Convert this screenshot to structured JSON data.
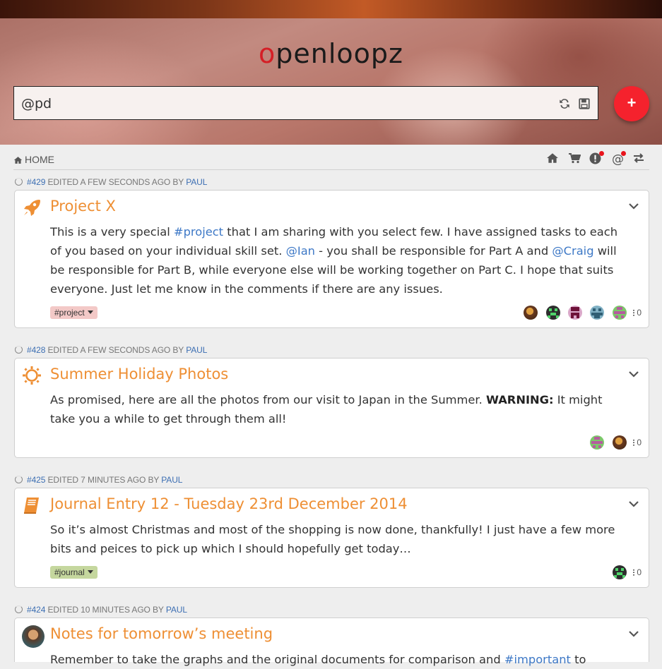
{
  "header": {
    "logo_text": "openloopz",
    "composer_value": "@pd",
    "add_label": "+"
  },
  "toolbar": {
    "breadcrumb": "HOME"
  },
  "posts": [
    {
      "id": "#429",
      "meta_text": "EDITED A FEW SECONDS AGO BY",
      "author": "PAUL",
      "icon": "rocket-icon",
      "title": "Project X",
      "body_parts": [
        "This is a very special ",
        "#project",
        " that I am sharing with you select few. I have assigned tasks to each of you based on your individual skill set. ",
        "@Ian",
        " - you shall be responsible for Part A and ",
        "@Craig",
        " will be responsible for Part B, while everyone else will be working together on Part C. I hope that suits everyone. Just let me know in the comments if there are any issues."
      ],
      "tag": "#project",
      "tag_color": "#f3c9c7",
      "comment_count": "0"
    },
    {
      "id": "#428",
      "meta_text": "EDITED A FEW SECONDS AGO BY",
      "author": "PAUL",
      "icon": "sun-icon",
      "title": "Summer Holiday Photos",
      "body_parts": [
        "As promised, here are all the photos from our visit to Japan in the Summer. ",
        "WARNING:",
        " It might take you a while to get through them all!"
      ],
      "comment_count": "0"
    },
    {
      "id": "#425",
      "meta_text": "EDITED 7 MINUTES AGO BY",
      "author": "PAUL",
      "icon": "book-icon",
      "title": "Journal Entry 12 - Tuesday 23rd December 2014",
      "body_parts": [
        "So it’s almost Christmas and most of the shopping is now done, thankfully! I just have a few more bits and peices to pick up which I should hopefully get today…"
      ],
      "tag": "#journal",
      "tag_color": "#c5d79e",
      "comment_count": "0"
    },
    {
      "id": "#424",
      "meta_text": "EDITED 10 MINUTES AGO BY",
      "author": "PAUL",
      "icon": "avatar",
      "title": "Notes for tomorrow’s meeting",
      "body_parts": [
        "Remember to take the graphs and the original documents for comparison and ",
        "#important",
        " to"
      ]
    }
  ]
}
